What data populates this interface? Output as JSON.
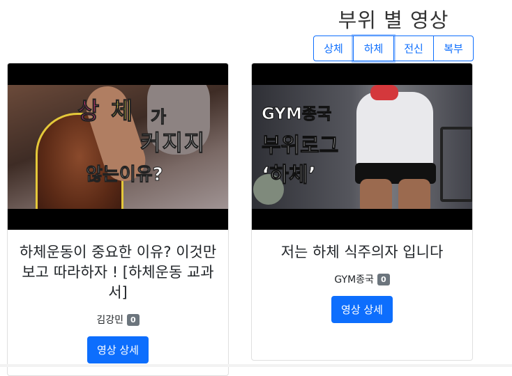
{
  "section": {
    "title": "부위 별 영상"
  },
  "tabs": [
    {
      "label": "상체",
      "active": false
    },
    {
      "label": "하체",
      "active": true
    },
    {
      "label": "전신",
      "active": false
    },
    {
      "label": "복부",
      "active": false
    }
  ],
  "videos": [
    {
      "thumbnail_text": [
        "상",
        "체",
        "가",
        "커지지",
        "않는이유?"
      ],
      "title": "하체운동이 중요한 이유? 이것만 보고 따라하자 ! [하체운동 교과서]",
      "author": "김강민",
      "count": "0",
      "button_label": "영상 상세"
    },
    {
      "thumbnail_text": [
        "GYM종국",
        "부위로그",
        "‘하체’"
      ],
      "title": "저는 하체 식주의자 입니다",
      "author": "GYM종국",
      "count": "0",
      "button_label": "영상 상세"
    }
  ],
  "colors": {
    "primary": "#0d6efd",
    "badge": "#6c757d"
  }
}
